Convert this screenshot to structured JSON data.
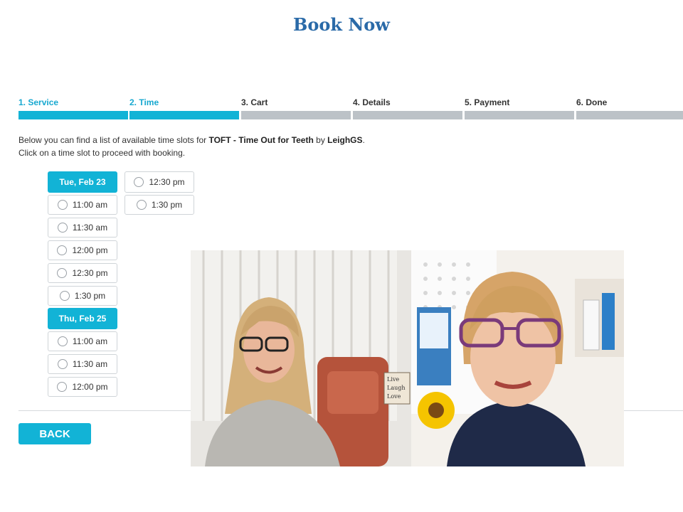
{
  "page": {
    "title": "Book Now"
  },
  "steps": [
    {
      "label": "1. Service",
      "active": true
    },
    {
      "label": "2. Time",
      "active": true
    },
    {
      "label": "3. Cart",
      "active": false
    },
    {
      "label": "4. Details",
      "active": false
    },
    {
      "label": "5. Payment",
      "active": false
    },
    {
      "label": "6. Done",
      "active": false
    }
  ],
  "intro": {
    "line1_prefix": "Below you can find a list of available time slots for ",
    "service": "TOFT - Time Out for Teeth",
    "by": " by ",
    "provider": "LeighGS",
    "period": ".",
    "line2": "Click on a time slot to proceed with booking."
  },
  "schedule": {
    "col1": {
      "day1": "Tue, Feb 23",
      "slots1": [
        "11:00 am",
        "11:30 am",
        "12:00 pm",
        "12:30 pm",
        "1:30 pm"
      ],
      "day2": "Thu, Feb 25",
      "slots2": [
        "11:00 am",
        "11:30 am",
        "12:00 pm"
      ]
    },
    "col2": {
      "slots": [
        "12:30 pm",
        "1:30 pm"
      ]
    }
  },
  "back_button": "BACK",
  "video_overlay": {
    "book_text": [
      "Live",
      "Laugh",
      "Love"
    ]
  },
  "colors": {
    "accent": "#12b3d6",
    "title": "#2a6aa8",
    "inactive_bar": "#bcc2c7"
  }
}
